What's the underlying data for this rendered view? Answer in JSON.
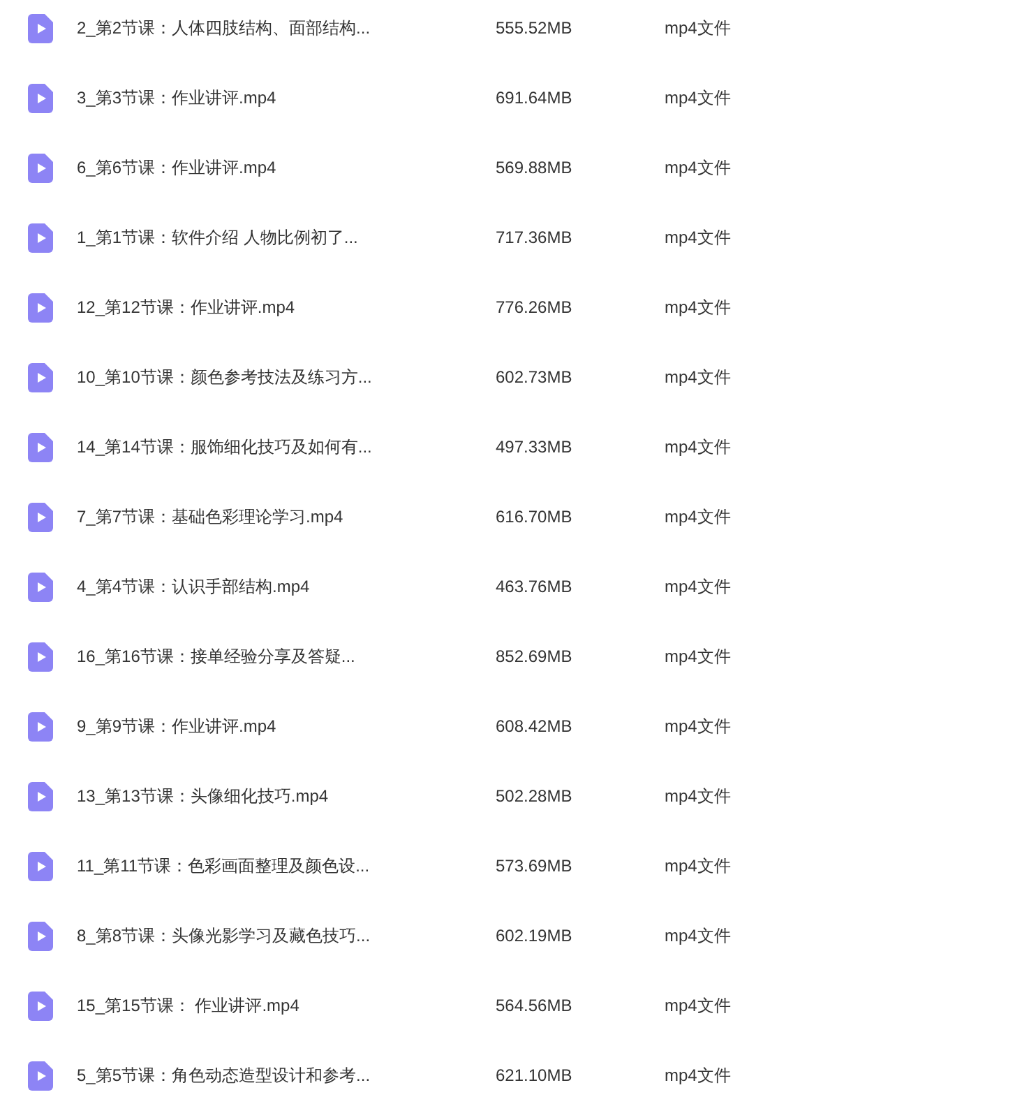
{
  "files": [
    {
      "name": "2_第2节课：人体四肢结构、面部结构...",
      "size": "555.52MB",
      "type": "mp4文件"
    },
    {
      "name": "3_第3节课：作业讲评.mp4",
      "size": "691.64MB",
      "type": "mp4文件"
    },
    {
      "name": "6_第6节课：作业讲评.mp4",
      "size": "569.88MB",
      "type": "mp4文件"
    },
    {
      "name": "1_第1节课：软件介绍 人物比例初了...",
      "size": "717.36MB",
      "type": "mp4文件"
    },
    {
      "name": "12_第12节课：作业讲评.mp4",
      "size": "776.26MB",
      "type": "mp4文件"
    },
    {
      "name": "10_第10节课：颜色参考技法及练习方...",
      "size": "602.73MB",
      "type": "mp4文件"
    },
    {
      "name": "14_第14节课：服饰细化技巧及如何有...",
      "size": "497.33MB",
      "type": "mp4文件"
    },
    {
      "name": "7_第7节课：基础色彩理论学习.mp4",
      "size": "616.70MB",
      "type": "mp4文件"
    },
    {
      "name": "4_第4节课：认识手部结构.mp4",
      "size": "463.76MB",
      "type": "mp4文件"
    },
    {
      "name": "16_第16节课：接单经验分享及答疑...",
      "size": "852.69MB",
      "type": "mp4文件"
    },
    {
      "name": "9_第9节课：作业讲评.mp4",
      "size": "608.42MB",
      "type": "mp4文件"
    },
    {
      "name": "13_第13节课：头像细化技巧.mp4",
      "size": "502.28MB",
      "type": "mp4文件"
    },
    {
      "name": "11_第11节课：色彩画面整理及颜色设...",
      "size": "573.69MB",
      "type": "mp4文件"
    },
    {
      "name": "8_第8节课：头像光影学习及藏色技巧...",
      "size": "602.19MB",
      "type": "mp4文件"
    },
    {
      "name": "15_第15节课： 作业讲评.mp4",
      "size": "564.56MB",
      "type": "mp4文件"
    },
    {
      "name": "5_第5节课：角色动态造型设计和参考...",
      "size": "621.10MB",
      "type": "mp4文件"
    }
  ]
}
